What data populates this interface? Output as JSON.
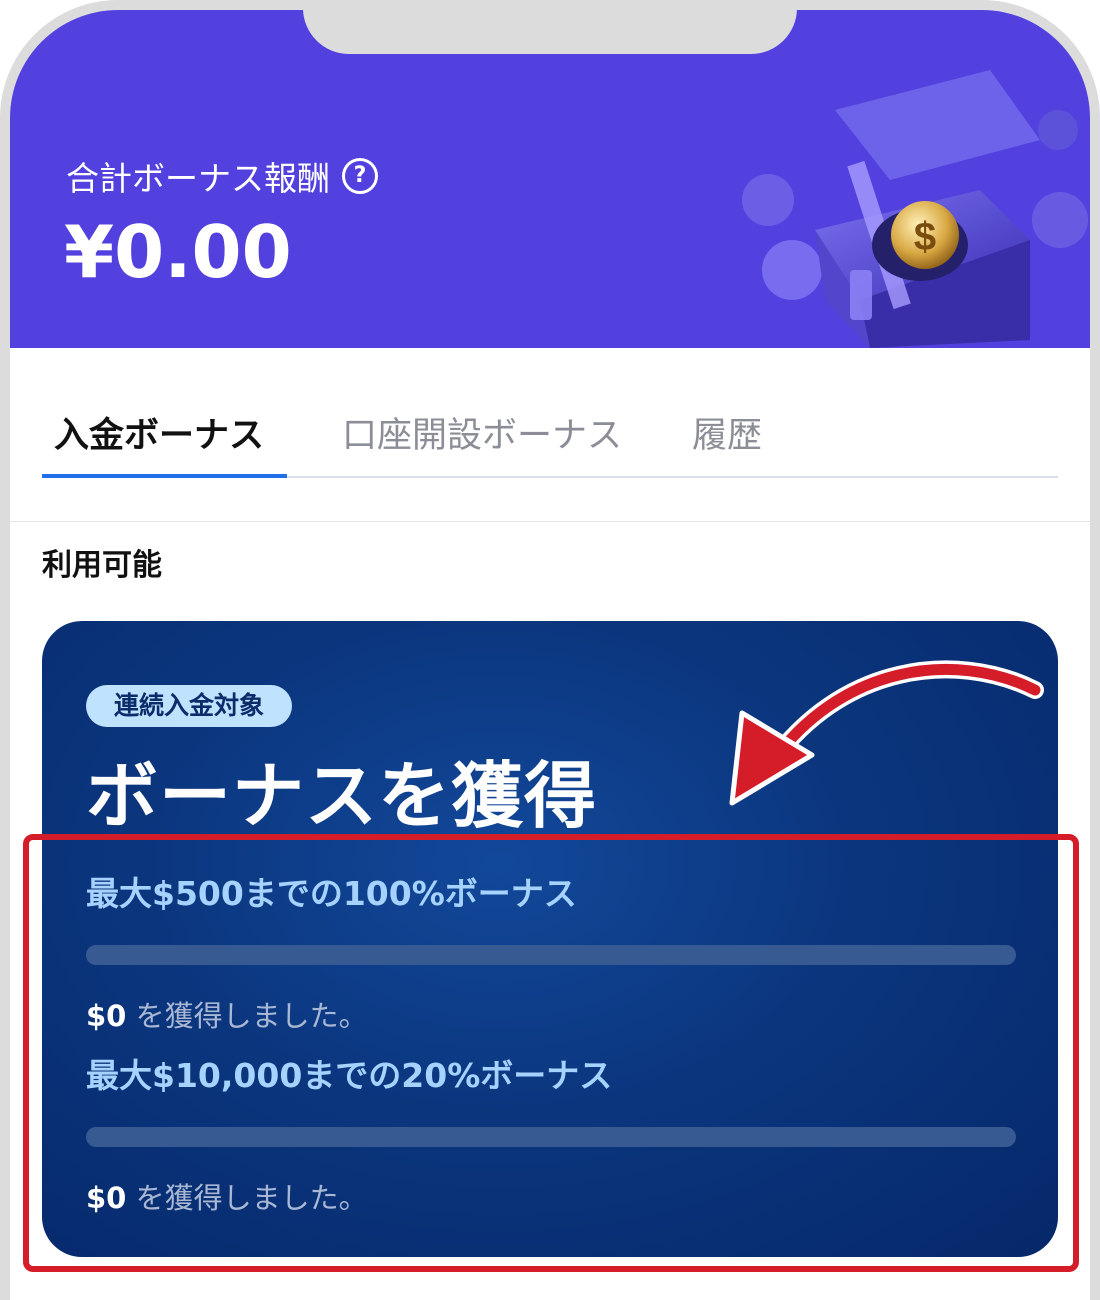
{
  "header": {
    "total_label": "合計ボーナス報酬",
    "help_icon": "question-circle-icon",
    "total_amount": "¥0.00",
    "background_color": "#5241de"
  },
  "tabs": [
    {
      "label": "入金ボーナス",
      "active": true
    },
    {
      "label": "口座開設ボーナス",
      "active": false
    },
    {
      "label": "履歴",
      "active": false
    }
  ],
  "section": {
    "available_label": "利用可能"
  },
  "bonus_card": {
    "badge": "連続入金対象",
    "title": "ボーナスを獲得",
    "tiers": [
      {
        "title": "最大$500までの100%ボーナス",
        "progress": 0,
        "earned_amount": "$0",
        "earned_suffix": " を獲得しました。"
      },
      {
        "title": "最大$10,000までの20%ボーナス",
        "progress": 0,
        "earned_amount": "$0",
        "earned_suffix": " を獲得しました。"
      }
    ]
  },
  "annotation": {
    "highlight_color": "#d51d2a"
  }
}
